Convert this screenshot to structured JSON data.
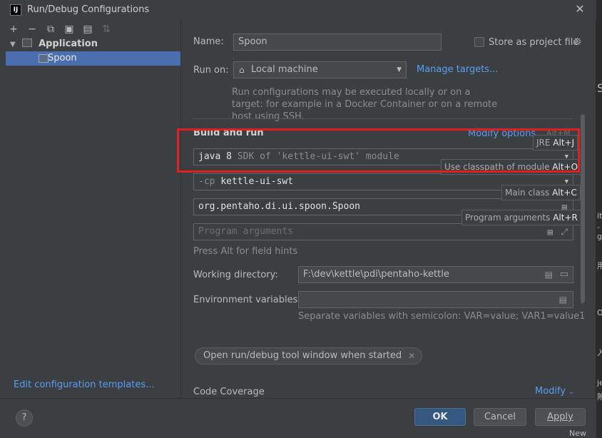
{
  "window": {
    "title": "Run/Debug Configurations",
    "app_icon_text": "IJ"
  },
  "toolbar": {
    "add": "+",
    "remove": "−",
    "copy": "⧉",
    "save": "▣",
    "folder": "▤",
    "sort": "⇅"
  },
  "tree": {
    "group_label": "Application",
    "item_label": "Spoon"
  },
  "left_footer": {
    "edit_templates": "Edit configuration templates..."
  },
  "form": {
    "name_label": "Name:",
    "name_value": "Spoon",
    "store_label": "Store as project file",
    "run_on_label": "Run on:",
    "run_on_value": "Local machine",
    "manage_targets": "Manage targets...",
    "run_on_description": "Run configurations may be executed locally or on a target: for example in a Docker Container or on a remote host using SSH.",
    "section_title": "Build and run",
    "modify_options": "Modify options",
    "modify_options_shortcut": "Alt+M",
    "jre_value_prefix": "java 8",
    "jre_value_suffix": "SDK of 'kettle-ui-swt' module",
    "cp_prefix": "-cp",
    "cp_value": "kettle-ui-swt",
    "main_class_value": "org.pentaho.di.ui.spoon.Spoon",
    "program_args_placeholder": "Program arguments",
    "alt_hint": "Press Alt for field hints",
    "working_dir_label": "Working directory:",
    "working_dir_value": "F:\\dev\\kettle\\pdi\\pentaho-kettle",
    "env_vars_label": "Environment variables:",
    "env_vars_value": "",
    "env_vars_hint": "Separate variables with semicolon: VAR=value; VAR1=value1",
    "chip_label": "Open run/debug tool window when started",
    "code_coverage_label": "Code Coverage",
    "modify_label": "Modify"
  },
  "tooltips": {
    "jre_text": "JRE",
    "jre_key": "Alt+J",
    "classpath_text": "Use classpath of module",
    "classpath_key": "Alt+O",
    "main_class_text": "Main class",
    "main_class_key": "Alt+C",
    "program_args_text": "Program arguments",
    "program_args_key": "Alt+R"
  },
  "buttons": {
    "help": "?",
    "ok": "OK",
    "cancel": "Cancel",
    "apply": "Apply"
  },
  "background_glyphs": {
    "g1": "S",
    "g2": "it",
    "g3": "-g",
    "g4": "用",
    "g5": "Om",
    "g6": "入",
    "g7": "je",
    "g8": "隙",
    "g9": "New"
  },
  "colors": {
    "accent_link": "#589df6",
    "selection": "#4b6eaf",
    "ok_button": "#365880",
    "highlight": "#e02020"
  }
}
